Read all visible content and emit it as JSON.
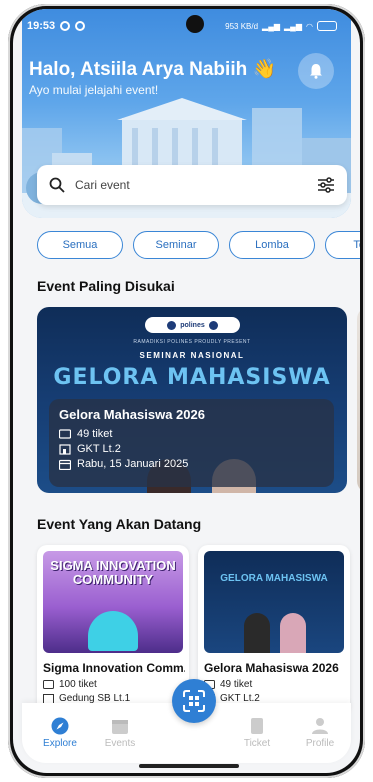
{
  "status": {
    "time": "19:53",
    "speed": "953 KB/d"
  },
  "header": {
    "greeting": "Halo, Atsiila Arya Nabiih 👋",
    "subtitle": "Ayo mulai jelajahi event!"
  },
  "search": {
    "placeholder": "Cari event"
  },
  "filters": [
    "Semua",
    "Seminar",
    "Lomba",
    "Techn"
  ],
  "sections": {
    "popular": "Event Paling Disukai",
    "upcoming": "Event Yang Akan Datang"
  },
  "featured": {
    "poster": {
      "brand": "polines",
      "present": "RAMADIKSI POLINES PROUDLY PRESENT",
      "kind": "SEMINAR NASIONAL",
      "headline": "GELORA MAHASISWA"
    },
    "title": "Gelora Mahasiswa 2026",
    "tickets": "49 tiket",
    "location": "GKT Lt.2",
    "date": "Rabu, 15 Januari 2025"
  },
  "upcoming": [
    {
      "poster": "SIGMA INNOVATION COMMUNITY",
      "title": "Sigma Innovation Comm...",
      "tickets": "100 tiket",
      "location": "Gedung SB Lt.1"
    },
    {
      "poster": "GELORA MAHASISWA",
      "title": "Gelora Mahasiswa 2026",
      "tickets": "49 tiket",
      "location": "GKT Lt.2"
    }
  ],
  "nav": {
    "explore": "Explore",
    "events": "Events",
    "ticket": "Ticket",
    "profile": "Profile"
  },
  "colors": {
    "primary": "#2f7fd4",
    "chip_border": "#3a86d6"
  }
}
